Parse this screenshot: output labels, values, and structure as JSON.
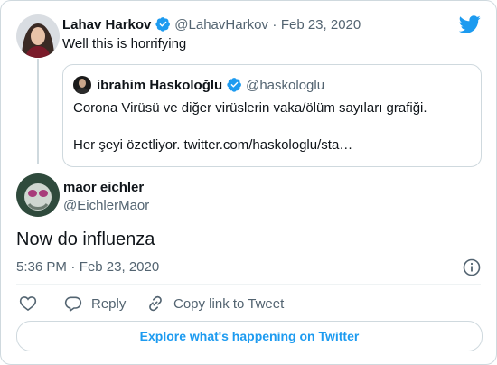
{
  "colors": {
    "accent": "#1d9bf0",
    "muted": "#536471",
    "border": "#cfd9de",
    "text": "#0f1419"
  },
  "parent_tweet": {
    "author_name": "Lahav Harkov",
    "handle": "@LahavHarkov",
    "separator": "·",
    "date": "Feb 23, 2020",
    "text": "Well this is horrifying"
  },
  "quoted_tweet": {
    "author_name": "ibrahim Haskoloğlu",
    "handle": "@haskologlu",
    "text_line1": "Corona Virüsü ve diğer virüslerin vaka/ölüm sayıları grafiği.",
    "text_line2": "Her şeyi özetliyor. twitter.com/haskologlu/sta…"
  },
  "main_tweet": {
    "author_name": "maor eichler",
    "handle": "@EichlerMaor",
    "text": "Now do influenza",
    "time": "5:36 PM",
    "separator": "·",
    "date": "Feb 23, 2020"
  },
  "actions": {
    "reply_label": "Reply",
    "copy_link_label": "Copy link to Tweet"
  },
  "explore_label": "Explore what's happening on Twitter",
  "icons": [
    "twitter-bird-icon",
    "verified-badge-icon",
    "info-icon",
    "heart-icon",
    "reply-icon",
    "link-icon"
  ]
}
